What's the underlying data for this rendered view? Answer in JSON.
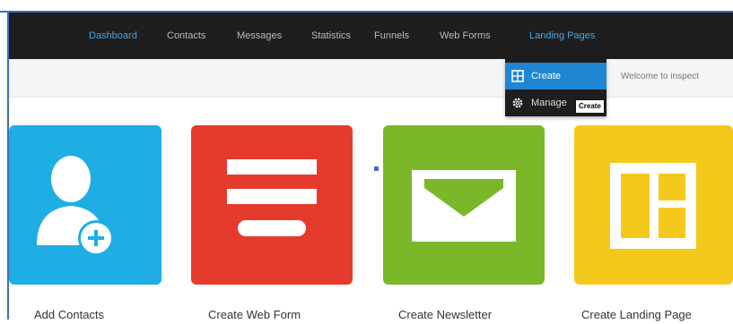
{
  "nav": {
    "items": [
      {
        "label": "Dashboard",
        "active": true
      },
      {
        "label": "Contacts",
        "active": false
      },
      {
        "label": "Messages",
        "active": false
      },
      {
        "label": "Statistics",
        "active": false
      },
      {
        "label": "Funnels",
        "active": false
      },
      {
        "label": "Web Forms",
        "active": false
      },
      {
        "label": "Landing Pages",
        "active": true
      }
    ]
  },
  "dropdown": {
    "items": [
      {
        "label": "Create",
        "icon": "grid-icon",
        "highlighted": true
      },
      {
        "label": "Manage",
        "icon": "gear-icon",
        "highlighted": false
      }
    ],
    "tooltip": "Create"
  },
  "header": {
    "welcome_text": "Welcome to inspect"
  },
  "tiles": [
    {
      "label": "Add Contacts",
      "icon": "add-contact-icon",
      "color": "#1faee3"
    },
    {
      "label": "Create Web Form",
      "icon": "web-form-icon",
      "color": "#e53b2c"
    },
    {
      "label": "Create Newsletter",
      "icon": "envelope-icon",
      "color": "#7ab829"
    },
    {
      "label": "Create Landing Page",
      "icon": "landing-page-icon",
      "color": "#f5c91b"
    }
  ],
  "colors": {
    "navbar": "#1e1e1e",
    "nav_active": "#4aa3e0",
    "dropdown_highlight": "#1f86d2"
  }
}
